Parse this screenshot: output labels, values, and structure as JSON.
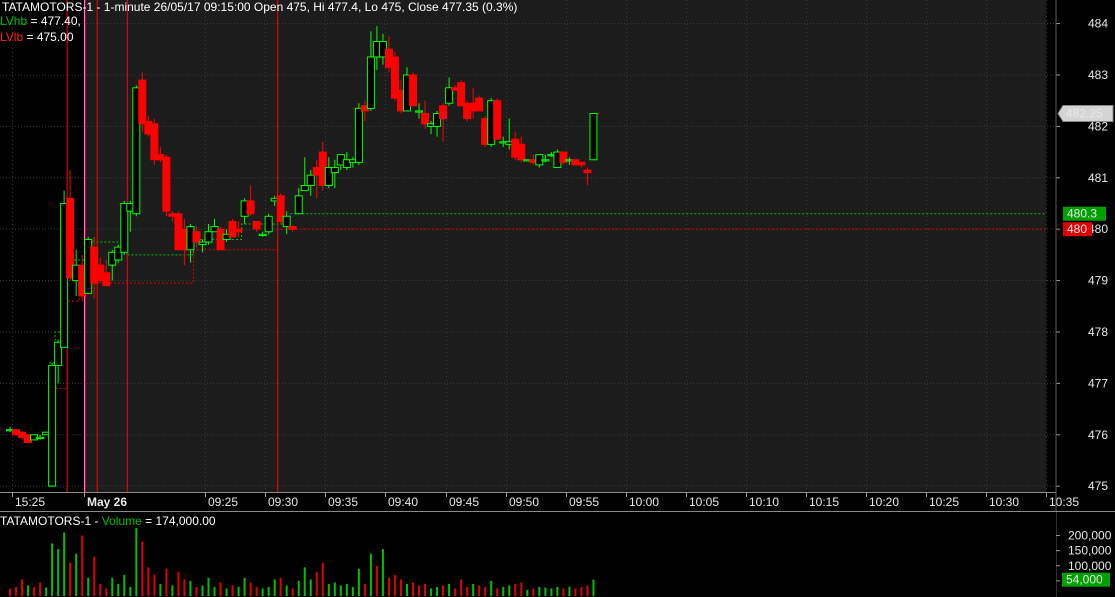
{
  "price_panel": {
    "header": "TATAMOTORS-1 - 1-minute 26/05/17 09:15:00 Open 475, Hi 477.4, Lo 475, Close 477.35 (0.3%)",
    "lvhb_label": "LVhb",
    "lvhb_value": " = 477.40,",
    "lvlb_label": "LVlb",
    "lvlb_value": " = 475.00"
  },
  "volume_panel": {
    "header_symbol": "TATAMOTORS-1 - ",
    "header_label": "Volume",
    "header_value": " = 174,000.00"
  },
  "colors": {
    "up": "#00ff00",
    "down": "#ff0000",
    "background": "#000000",
    "session_background": "#1c1c1c",
    "grid": "#3a3a3a",
    "label_grey": "#d4d4d4",
    "label_green": "#00a000",
    "label_red": "#e00000"
  },
  "chart_data": {
    "type": "candlestick",
    "title": "TATAMOTORS-1 - 1-minute",
    "y_axis": {
      "ticks": [
        475,
        476,
        477,
        478,
        479,
        480,
        481,
        482,
        483,
        484
      ],
      "range": [
        474.8,
        484.4
      ]
    },
    "x_axis": {
      "ticks": [
        "15:25",
        "May 26",
        "09:25",
        "09:30",
        "09:35",
        "09:40",
        "09:45",
        "09:50",
        "09:55",
        "10:00",
        "10:05",
        "10:10",
        "10:15",
        "10:20",
        "10:25",
        "10:30",
        "10:35"
      ]
    },
    "price_labels": [
      {
        "text": "482.25",
        "value": 482.25,
        "style": "grey"
      },
      {
        "text": "480.3",
        "value": 480.3,
        "style": "green"
      },
      {
        "text": "480",
        "value": 480,
        "style": "red"
      }
    ],
    "candles": [
      {
        "o": 476.1,
        "h": 476.15,
        "l": 476.05,
        "c": 476.1
      },
      {
        "o": 476.1,
        "h": 476.1,
        "l": 476.0,
        "c": 476.0
      },
      {
        "o": 476.05,
        "h": 476.05,
        "l": 475.9,
        "c": 475.95
      },
      {
        "o": 476.0,
        "h": 476.0,
        "l": 475.85,
        "c": 475.85
      },
      {
        "o": 475.9,
        "h": 476.0,
        "l": 475.9,
        "c": 476.0
      },
      {
        "o": 475.95,
        "h": 476.0,
        "l": 475.9,
        "c": 475.95
      },
      {
        "o": 476.0,
        "h": 476.05,
        "l": 476.0,
        "c": 476.05
      },
      {
        "o": 475.0,
        "h": 477.4,
        "l": 475.0,
        "c": 477.35
      },
      {
        "o": 477.35,
        "h": 477.85,
        "l": 477.0,
        "c": 477.8
      },
      {
        "o": 477.7,
        "h": 480.75,
        "l": 477.7,
        "c": 480.5
      },
      {
        "o": 480.6,
        "h": 481.15,
        "l": 479.0,
        "c": 479.05
      },
      {
        "o": 479.0,
        "h": 479.6,
        "l": 478.7,
        "c": 479.3
      },
      {
        "o": 479.3,
        "h": 479.5,
        "l": 478.6,
        "c": 478.7
      },
      {
        "o": 478.75,
        "h": 479.85,
        "l": 478.75,
        "c": 479.8
      },
      {
        "o": 479.65,
        "h": 479.85,
        "l": 478.65,
        "c": 478.95
      },
      {
        "o": 479.3,
        "h": 479.45,
        "l": 478.95,
        "c": 479.0
      },
      {
        "o": 479.15,
        "h": 479.4,
        "l": 478.9,
        "c": 478.9
      },
      {
        "o": 479.3,
        "h": 479.6,
        "l": 479.0,
        "c": 479.55
      },
      {
        "o": 479.4,
        "h": 479.7,
        "l": 479.35,
        "c": 479.65
      },
      {
        "o": 479.55,
        "h": 480.55,
        "l": 479.5,
        "c": 480.5
      },
      {
        "o": 480.35,
        "h": 480.55,
        "l": 479.95,
        "c": 480.5
      },
      {
        "o": 480.3,
        "h": 482.8,
        "l": 480.25,
        "c": 482.75
      },
      {
        "o": 482.9,
        "h": 483.05,
        "l": 481.9,
        "c": 482.05
      },
      {
        "o": 482.1,
        "h": 482.2,
        "l": 481.8,
        "c": 481.85
      },
      {
        "o": 482.05,
        "h": 482.15,
        "l": 481.25,
        "c": 481.35
      },
      {
        "o": 481.45,
        "h": 481.6,
        "l": 481.3,
        "c": 481.35
      },
      {
        "o": 481.4,
        "h": 481.45,
        "l": 480.25,
        "c": 480.35
      },
      {
        "o": 480.3,
        "h": 480.35,
        "l": 480.15,
        "c": 480.25
      },
      {
        "o": 480.3,
        "h": 480.35,
        "l": 479.6,
        "c": 479.6
      },
      {
        "o": 480.0,
        "h": 480.2,
        "l": 479.3,
        "c": 479.6
      },
      {
        "o": 479.6,
        "h": 480.1,
        "l": 479.35,
        "c": 480.05
      },
      {
        "o": 479.95,
        "h": 480.05,
        "l": 479.65,
        "c": 479.75
      },
      {
        "o": 479.7,
        "h": 479.8,
        "l": 479.55,
        "c": 479.75
      },
      {
        "o": 479.75,
        "h": 480.1,
        "l": 479.7,
        "c": 479.95
      },
      {
        "o": 479.95,
        "h": 480.2,
        "l": 479.95,
        "c": 480.05
      },
      {
        "o": 480.0,
        "h": 480.05,
        "l": 479.6,
        "c": 479.6
      },
      {
        "o": 479.8,
        "h": 480.0,
        "l": 479.75,
        "c": 479.9
      },
      {
        "o": 480.15,
        "h": 480.2,
        "l": 479.85,
        "c": 479.85
      },
      {
        "o": 480.0,
        "h": 480.15,
        "l": 479.85,
        "c": 479.95
      },
      {
        "o": 480.25,
        "h": 480.6,
        "l": 480.1,
        "c": 480.55
      },
      {
        "o": 480.55,
        "h": 480.85,
        "l": 480.25,
        "c": 480.3
      },
      {
        "o": 480.15,
        "h": 480.15,
        "l": 479.95,
        "c": 480.0
      },
      {
        "o": 479.9,
        "h": 479.95,
        "l": 479.85,
        "c": 479.9
      },
      {
        "o": 479.95,
        "h": 480.3,
        "l": 479.9,
        "c": 480.25
      },
      {
        "o": 480.55,
        "h": 480.65,
        "l": 480.45,
        "c": 480.6
      },
      {
        "o": 480.65,
        "h": 480.7,
        "l": 480.1,
        "c": 480.15
      },
      {
        "o": 480.05,
        "h": 480.35,
        "l": 479.9,
        "c": 480.25
      },
      {
        "o": 480.05,
        "h": 480.05,
        "l": 479.95,
        "c": 480.0
      },
      {
        "o": 480.3,
        "h": 480.8,
        "l": 480.3,
        "c": 480.65
      },
      {
        "o": 480.75,
        "h": 481.4,
        "l": 480.75,
        "c": 480.85
      },
      {
        "o": 480.85,
        "h": 481.15,
        "l": 480.65,
        "c": 481.05
      },
      {
        "o": 481.2,
        "h": 481.35,
        "l": 480.6,
        "c": 481.05
      },
      {
        "o": 481.5,
        "h": 481.7,
        "l": 480.75,
        "c": 480.85
      },
      {
        "o": 480.85,
        "h": 481.4,
        "l": 480.8,
        "c": 481.2
      },
      {
        "o": 481.1,
        "h": 481.35,
        "l": 480.8,
        "c": 481.2
      },
      {
        "o": 481.25,
        "h": 481.45,
        "l": 481.15,
        "c": 481.45
      },
      {
        "o": 481.2,
        "h": 481.5,
        "l": 481.15,
        "c": 481.35
      },
      {
        "o": 481.3,
        "h": 481.4,
        "l": 481.2,
        "c": 481.35
      },
      {
        "o": 481.3,
        "h": 482.45,
        "l": 481.25,
        "c": 482.35
      },
      {
        "o": 482.4,
        "h": 482.5,
        "l": 482.1,
        "c": 482.3
      },
      {
        "o": 482.35,
        "h": 483.85,
        "l": 482.3,
        "c": 483.35
      },
      {
        "o": 483.35,
        "h": 483.95,
        "l": 483.1,
        "c": 483.65
      },
      {
        "o": 483.35,
        "h": 483.8,
        "l": 483.2,
        "c": 483.65
      },
      {
        "o": 483.5,
        "h": 483.75,
        "l": 483.05,
        "c": 483.15
      },
      {
        "o": 483.35,
        "h": 483.45,
        "l": 482.5,
        "c": 482.55
      },
      {
        "o": 482.7,
        "h": 482.9,
        "l": 482.25,
        "c": 482.3
      },
      {
        "o": 482.3,
        "h": 483.15,
        "l": 482.3,
        "c": 483.0
      },
      {
        "o": 483.0,
        "h": 483.05,
        "l": 482.4,
        "c": 482.4
      },
      {
        "o": 482.3,
        "h": 482.45,
        "l": 482.15,
        "c": 482.3
      },
      {
        "o": 482.25,
        "h": 482.5,
        "l": 481.95,
        "c": 482.05
      },
      {
        "o": 482.0,
        "h": 482.1,
        "l": 481.85,
        "c": 482.05
      },
      {
        "o": 482.0,
        "h": 482.3,
        "l": 481.8,
        "c": 482.25
      },
      {
        "o": 482.4,
        "h": 482.45,
        "l": 481.7,
        "c": 482.15
      },
      {
        "o": 482.45,
        "h": 482.95,
        "l": 482.4,
        "c": 482.75
      },
      {
        "o": 482.75,
        "h": 482.8,
        "l": 482.7,
        "c": 482.7
      },
      {
        "o": 482.85,
        "h": 482.9,
        "l": 482.4,
        "c": 482.4
      },
      {
        "o": 482.45,
        "h": 482.5,
        "l": 482.1,
        "c": 482.15
      },
      {
        "o": 482.45,
        "h": 482.75,
        "l": 482.15,
        "c": 482.3
      },
      {
        "o": 482.55,
        "h": 482.6,
        "l": 482.3,
        "c": 482.3
      },
      {
        "o": 482.15,
        "h": 482.2,
        "l": 481.6,
        "c": 481.65
      },
      {
        "o": 481.65,
        "h": 482.55,
        "l": 481.6,
        "c": 482.5
      },
      {
        "o": 482.5,
        "h": 482.55,
        "l": 481.75,
        "c": 481.75
      },
      {
        "o": 481.7,
        "h": 481.8,
        "l": 481.6,
        "c": 481.7
      },
      {
        "o": 481.65,
        "h": 482.15,
        "l": 481.55,
        "c": 481.7
      },
      {
        "o": 481.75,
        "h": 481.9,
        "l": 481.35,
        "c": 481.4
      },
      {
        "o": 481.65,
        "h": 481.8,
        "l": 481.3,
        "c": 481.35
      },
      {
        "o": 481.35,
        "h": 481.35,
        "l": 481.35,
        "c": 481.35
      },
      {
        "o": 481.35,
        "h": 481.45,
        "l": 481.25,
        "c": 481.3
      },
      {
        "o": 481.25,
        "h": 481.45,
        "l": 481.2,
        "c": 481.45
      },
      {
        "o": 481.35,
        "h": 481.45,
        "l": 481.3,
        "c": 481.35
      },
      {
        "o": 481.45,
        "h": 481.5,
        "l": 481.4,
        "c": 481.45
      },
      {
        "o": 481.2,
        "h": 481.55,
        "l": 481.2,
        "c": 481.5
      },
      {
        "o": 481.5,
        "h": 481.5,
        "l": 481.25,
        "c": 481.3
      },
      {
        "o": 481.35,
        "h": 481.4,
        "l": 481.25,
        "c": 481.35
      },
      {
        "o": 481.35,
        "h": 481.35,
        "l": 481.25,
        "c": 481.25
      },
      {
        "o": 481.3,
        "h": 481.3,
        "l": 481.2,
        "c": 481.25
      },
      {
        "o": 481.15,
        "h": 481.2,
        "l": 480.85,
        "c": 481.1
      },
      {
        "o": 481.35,
        "h": 482.25,
        "l": 481.35,
        "c": 482.25
      }
    ],
    "volume": {
      "y_axis": {
        "ticks": [
          "200,000",
          "150,000",
          "100,000",
          "50,000"
        ]
      },
      "last_value_label": "54,000",
      "bars": [
        {
          "v": 25000,
          "d": "down"
        },
        {
          "v": 30000,
          "d": "down"
        },
        {
          "v": 55000,
          "d": "down"
        },
        {
          "v": 35000,
          "d": "up"
        },
        {
          "v": 30000,
          "d": "down"
        },
        {
          "v": 45000,
          "d": "down"
        },
        {
          "v": 28000,
          "d": "up"
        },
        {
          "v": 174000,
          "d": "up"
        },
        {
          "v": 155000,
          "d": "up"
        },
        {
          "v": 210000,
          "d": "up"
        },
        {
          "v": 110000,
          "d": "down"
        },
        {
          "v": 140000,
          "d": "up"
        },
        {
          "v": 200000,
          "d": "down"
        },
        {
          "v": 60000,
          "d": "up"
        },
        {
          "v": 130000,
          "d": "down"
        },
        {
          "v": 40000,
          "d": "down"
        },
        {
          "v": 25000,
          "d": "down"
        },
        {
          "v": 60000,
          "d": "up"
        },
        {
          "v": 40000,
          "d": "up"
        },
        {
          "v": 70000,
          "d": "up"
        },
        {
          "v": 30000,
          "d": "up"
        },
        {
          "v": 225000,
          "d": "up"
        },
        {
          "v": 180000,
          "d": "down"
        },
        {
          "v": 95000,
          "d": "down"
        },
        {
          "v": 70000,
          "d": "down"
        },
        {
          "v": 40000,
          "d": "up"
        },
        {
          "v": 90000,
          "d": "down"
        },
        {
          "v": 35000,
          "d": "up"
        },
        {
          "v": 80000,
          "d": "down"
        },
        {
          "v": 55000,
          "d": "down"
        },
        {
          "v": 50000,
          "d": "up"
        },
        {
          "v": 30000,
          "d": "down"
        },
        {
          "v": 35000,
          "d": "up"
        },
        {
          "v": 60000,
          "d": "up"
        },
        {
          "v": 30000,
          "d": "up"
        },
        {
          "v": 45000,
          "d": "down"
        },
        {
          "v": 25000,
          "d": "up"
        },
        {
          "v": 35000,
          "d": "down"
        },
        {
          "v": 30000,
          "d": "up"
        },
        {
          "v": 60000,
          "d": "up"
        },
        {
          "v": 45000,
          "d": "down"
        },
        {
          "v": 30000,
          "d": "down"
        },
        {
          "v": 25000,
          "d": "up"
        },
        {
          "v": 30000,
          "d": "up"
        },
        {
          "v": 55000,
          "d": "up"
        },
        {
          "v": 60000,
          "d": "down"
        },
        {
          "v": 35000,
          "d": "up"
        },
        {
          "v": 25000,
          "d": "down"
        },
        {
          "v": 50000,
          "d": "up"
        },
        {
          "v": 95000,
          "d": "up"
        },
        {
          "v": 55000,
          "d": "up"
        },
        {
          "v": 80000,
          "d": "down"
        },
        {
          "v": 110000,
          "d": "down"
        },
        {
          "v": 40000,
          "d": "up"
        },
        {
          "v": 45000,
          "d": "up"
        },
        {
          "v": 35000,
          "d": "up"
        },
        {
          "v": 40000,
          "d": "up"
        },
        {
          "v": 30000,
          "d": "up"
        },
        {
          "v": 90000,
          "d": "up"
        },
        {
          "v": 40000,
          "d": "down"
        },
        {
          "v": 140000,
          "d": "up"
        },
        {
          "v": 100000,
          "d": "down"
        },
        {
          "v": 155000,
          "d": "up"
        },
        {
          "v": 60000,
          "d": "down"
        },
        {
          "v": 70000,
          "d": "down"
        },
        {
          "v": 55000,
          "d": "down"
        },
        {
          "v": 40000,
          "d": "up"
        },
        {
          "v": 45000,
          "d": "down"
        },
        {
          "v": 35000,
          "d": "down"
        },
        {
          "v": 40000,
          "d": "down"
        },
        {
          "v": 25000,
          "d": "up"
        },
        {
          "v": 30000,
          "d": "up"
        },
        {
          "v": 35000,
          "d": "down"
        },
        {
          "v": 40000,
          "d": "up"
        },
        {
          "v": 25000,
          "d": "down"
        },
        {
          "v": 55000,
          "d": "down"
        },
        {
          "v": 30000,
          "d": "down"
        },
        {
          "v": 40000,
          "d": "up"
        },
        {
          "v": 35000,
          "d": "down"
        },
        {
          "v": 30000,
          "d": "down"
        },
        {
          "v": 50000,
          "d": "up"
        },
        {
          "v": 25000,
          "d": "down"
        },
        {
          "v": 30000,
          "d": "up"
        },
        {
          "v": 35000,
          "d": "up"
        },
        {
          "v": 40000,
          "d": "down"
        },
        {
          "v": 45000,
          "d": "down"
        },
        {
          "v": 20000,
          "d": "up"
        },
        {
          "v": 25000,
          "d": "down"
        },
        {
          "v": 30000,
          "d": "up"
        },
        {
          "v": 28000,
          "d": "up"
        },
        {
          "v": 25000,
          "d": "up"
        },
        {
          "v": 30000,
          "d": "up"
        },
        {
          "v": 25000,
          "d": "down"
        },
        {
          "v": 30000,
          "d": "up"
        },
        {
          "v": 25000,
          "d": "down"
        },
        {
          "v": 30000,
          "d": "down"
        },
        {
          "v": 35000,
          "d": "down"
        },
        {
          "v": 54000,
          "d": "up"
        }
      ]
    },
    "session_markers": [
      10,
      13,
      15,
      20,
      45
    ],
    "overlays": [
      {
        "name": "LVhb",
        "color": "green",
        "steps": [
          {
            "from": 7,
            "level": 477.4
          },
          {
            "from": 8,
            "level": 478.0
          },
          {
            "from": 9,
            "level": 479.4
          },
          {
            "from": 13,
            "level": 479.75
          },
          {
            "from": 20,
            "level": 479.5
          },
          {
            "from": 31,
            "level": 479.8
          },
          {
            "from": 39,
            "level": 480.1
          },
          {
            "from": 47,
            "level": 480.3
          }
        ]
      },
      {
        "name": "LVlb",
        "color": "red",
        "steps": [
          {
            "from": 7,
            "level": 475.0
          },
          {
            "from": 8,
            "level": 476.9
          },
          {
            "from": 10,
            "level": 478.6
          },
          {
            "from": 12,
            "level": 478.95
          },
          {
            "from": 31,
            "level": 479.6
          },
          {
            "from": 45,
            "level": 480.0
          }
        ]
      }
    ]
  }
}
